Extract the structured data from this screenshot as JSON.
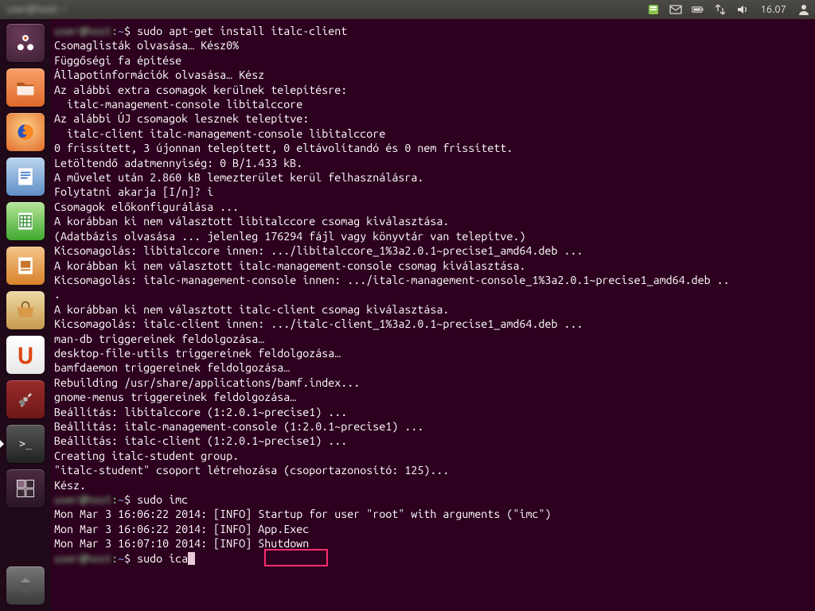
{
  "topbar": {
    "title_blurred": "user@host: ~",
    "clock": "16.07"
  },
  "launcher": [
    {
      "name": "dash",
      "label": "Dash"
    },
    {
      "name": "files",
      "label": "Files"
    },
    {
      "name": "firefox",
      "label": "Firefox"
    },
    {
      "name": "writer",
      "label": "LibreOffice Writer"
    },
    {
      "name": "calc",
      "label": "LibreOffice Calc"
    },
    {
      "name": "impress",
      "label": "LibreOffice Impress"
    },
    {
      "name": "software",
      "label": "Ubuntu Software Center"
    },
    {
      "name": "ubuntuone",
      "label": "Ubuntu One"
    },
    {
      "name": "settings",
      "label": "System Settings"
    },
    {
      "name": "terminal",
      "label": "Terminal"
    },
    {
      "name": "workspace",
      "label": "Workspace Switcher"
    },
    {
      "name": "trash",
      "label": "Trash"
    }
  ],
  "terminal": {
    "prompt_user_blurred": "user@host",
    "prompt_path": "~",
    "lines": {
      "l0": "sudo apt-get install italc-client",
      "l1": "Csomaglisták olvasása… Kész0%",
      "l2": "Függőségi fa építése",
      "l3": "Állapotinformációk olvasása… Kész",
      "l4": "Az alábbi extra csomagok kerülnek telepítésre:",
      "l5": "  italc-management-console libitalccore",
      "l6": "Az alábbi ÚJ csomagok lesznek telepítve:",
      "l7": "  italc-client italc-management-console libitalccore",
      "l8": "0 frissített, 3 újonnan telepített, 0 eltávolítandó és 0 nem frissített.",
      "l9": "Letöltendő adatmennyiség: 0 B/1.433 kB.",
      "l10": "A művelet után 2.860 kB lemezterület kerül felhasználásra.",
      "l11": "Folytatni akarja [I/n]? i",
      "l12": "Csomagok előkonfigurálása ...",
      "l13": "A korábban ki nem választott libitalccore csomag kiválasztása.",
      "l14": "(Adatbázis olvasása ... jelenleg 176294 fájl vagy könyvtár van telepítve.)",
      "l15": "Kicsomagolás: libitalccore innen: .../libitalccore_1%3a2.0.1~precise1_amd64.deb ...",
      "l16": "A korábban ki nem választott italc-management-console csomag kiválasztása.",
      "l17": "Kicsomagolás: italc-management-console innen: .../italc-management-console_1%3a2.0.1~precise1_amd64.deb ..",
      "l18": ".",
      "l19": "A korábban ki nem választott italc-client csomag kiválasztása.",
      "l20": "Kicsomagolás: italc-client innen: .../italc-client_1%3a2.0.1~precise1_amd64.deb ...",
      "l21": "man-db triggereinek feldolgozása…",
      "l22": "desktop-file-utils triggereinek feldolgozása…",
      "l23": "bamfdaemon triggereinek feldolgozása…",
      "l24": "Rebuilding /usr/share/applications/bamf.index...",
      "l25": "gnome-menus triggereinek feldolgozása…",
      "l26": "Beállítás: libitalccore (1:2.0.1~precise1) ...",
      "l27": "Beállítás: italc-management-console (1:2.0.1~precise1) ...",
      "l28": "Beállítás: italc-client (1:2.0.1~precise1) ...",
      "l29": "Creating italc-student group.",
      "l30": "\"italc-student\" csoport létrehozása (csoportazonosító: 125)...",
      "l31": "Kész.",
      "l32_cmd": "sudo imc",
      "l33": "Mon Mar 3 16:06:22 2014: [INFO] Startup for user \"root\" with arguments (\"imc\")",
      "l34": "Mon Mar 3 16:06:22 2014: [INFO] App.Exec",
      "l35": "Mon Mar 3 16:07:10 2014: [INFO] Shutdown",
      "l36_cmd": "sudo ica"
    }
  }
}
